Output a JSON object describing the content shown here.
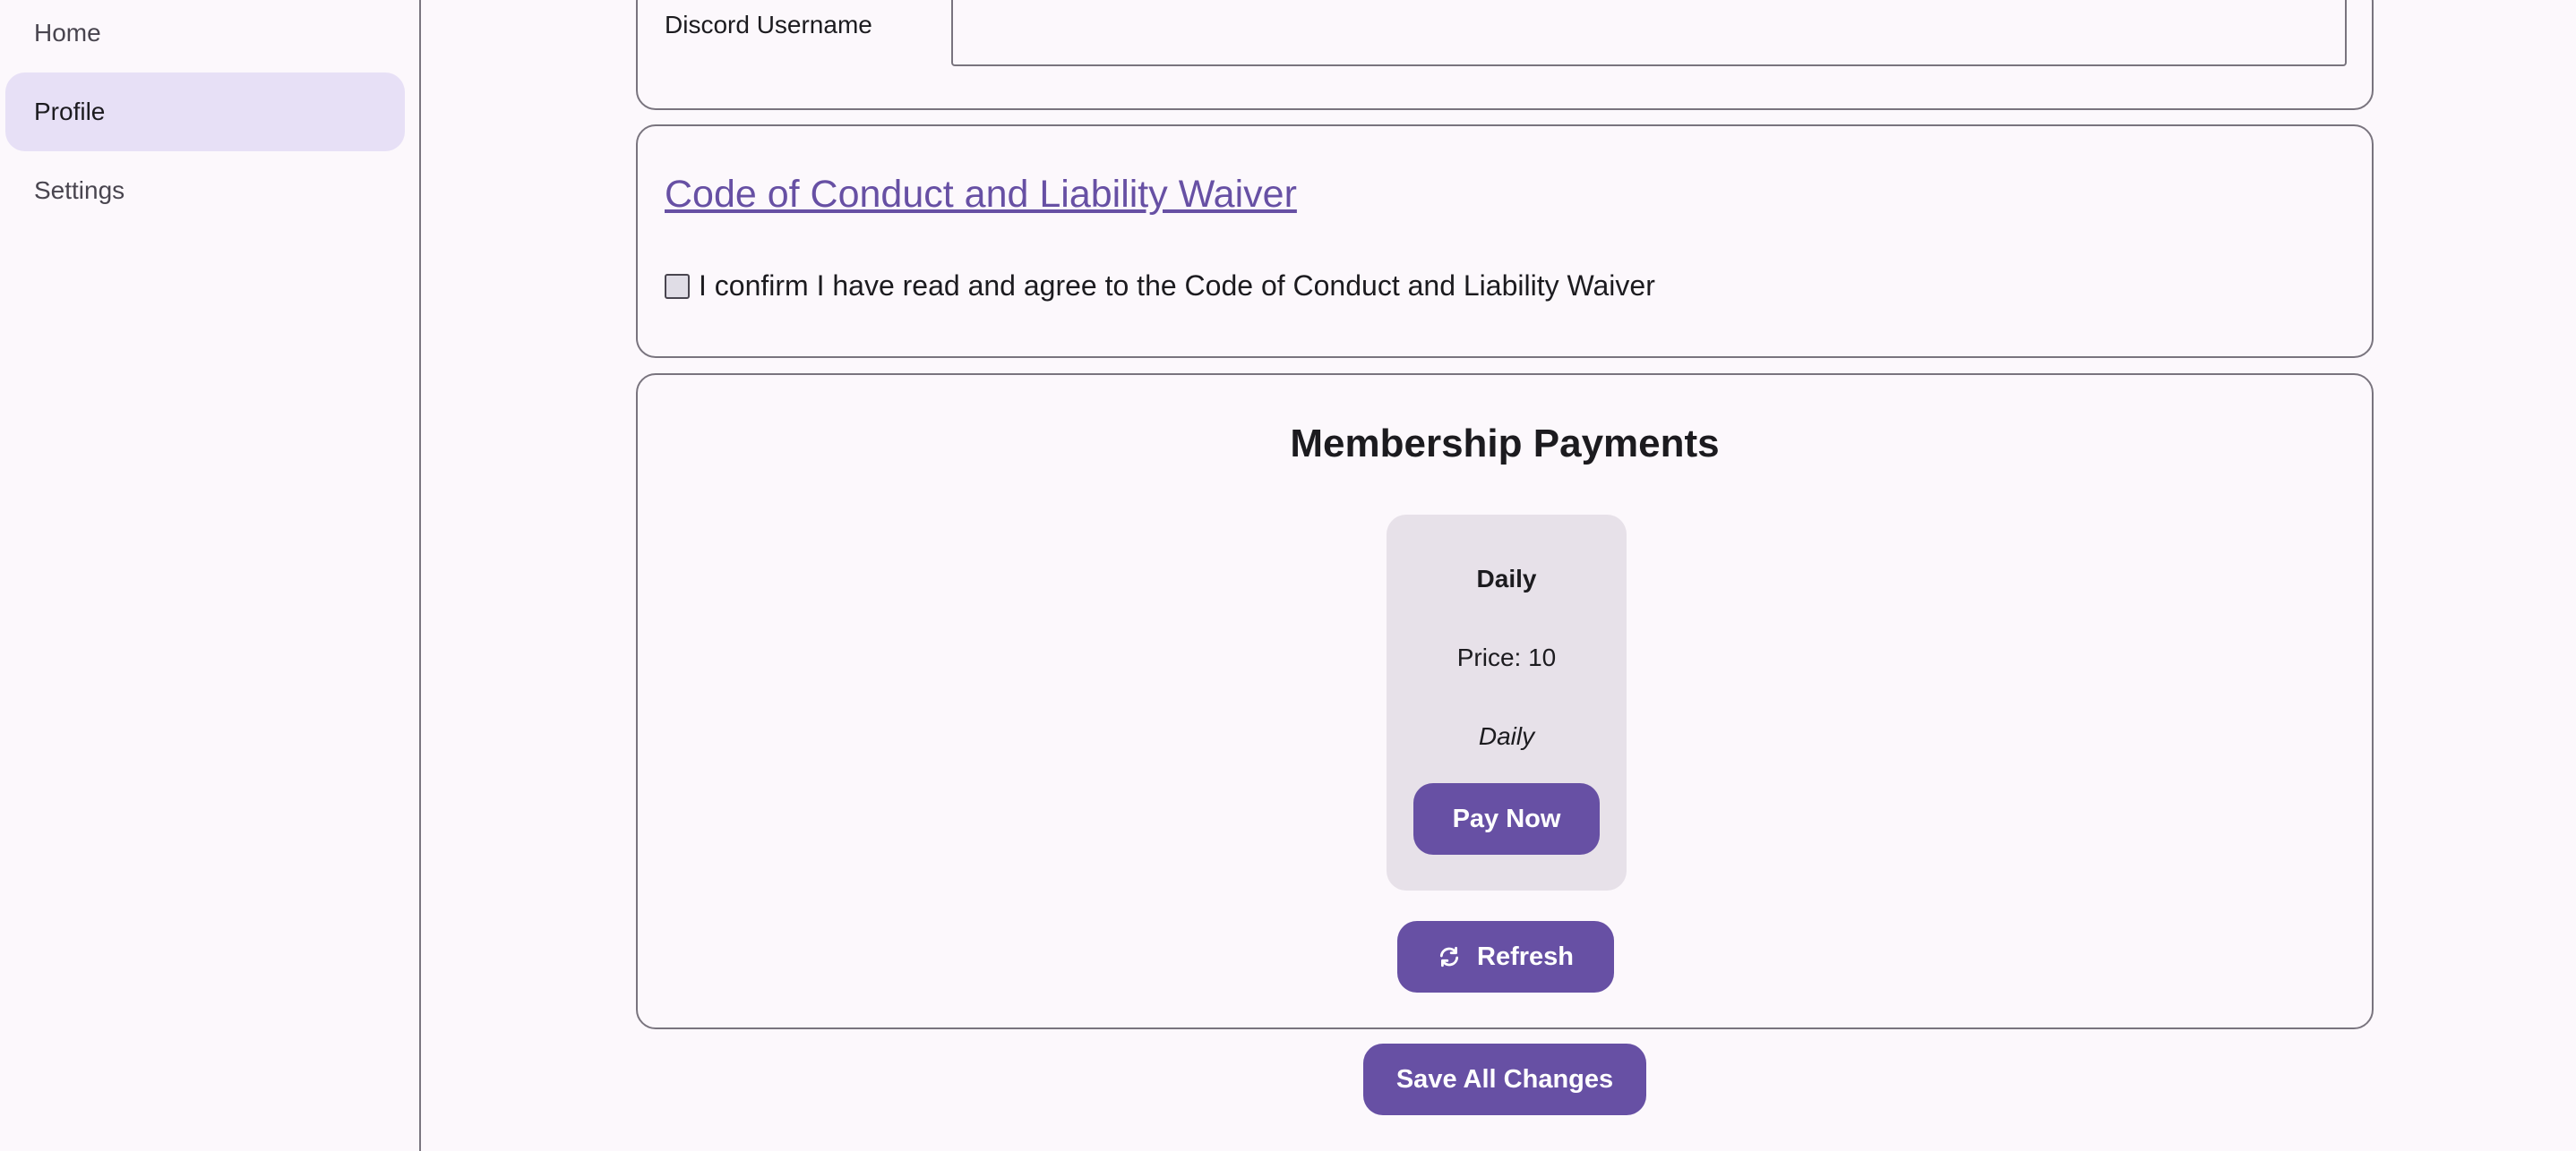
{
  "sidebar": {
    "items": [
      {
        "label": "Home"
      },
      {
        "label": "Profile"
      },
      {
        "label": "Settings"
      }
    ],
    "active": "Profile"
  },
  "profile": {
    "discord_label": "Discord Username",
    "discord_value": ""
  },
  "code_of_conduct": {
    "link_text": "Code of Conduct and Liability Waiver",
    "checkbox_label": "I confirm I have read and agree to the Code of Conduct and Liability Waiver",
    "checked": false
  },
  "membership": {
    "title": "Membership Payments",
    "plans": [
      {
        "name": "Daily",
        "price": "Price: 10",
        "frequency": "Daily",
        "button": "Pay Now"
      }
    ],
    "refresh_label": "Refresh",
    "refresh_icon": "refresh-icon"
  },
  "actions": {
    "save_label": "Save All Changes"
  },
  "colors": {
    "primary": "#6750a4",
    "sidebar_active": "#e7e0f6",
    "plan_card_bg": "#e7e1e9",
    "background": "#fcf8fc"
  }
}
